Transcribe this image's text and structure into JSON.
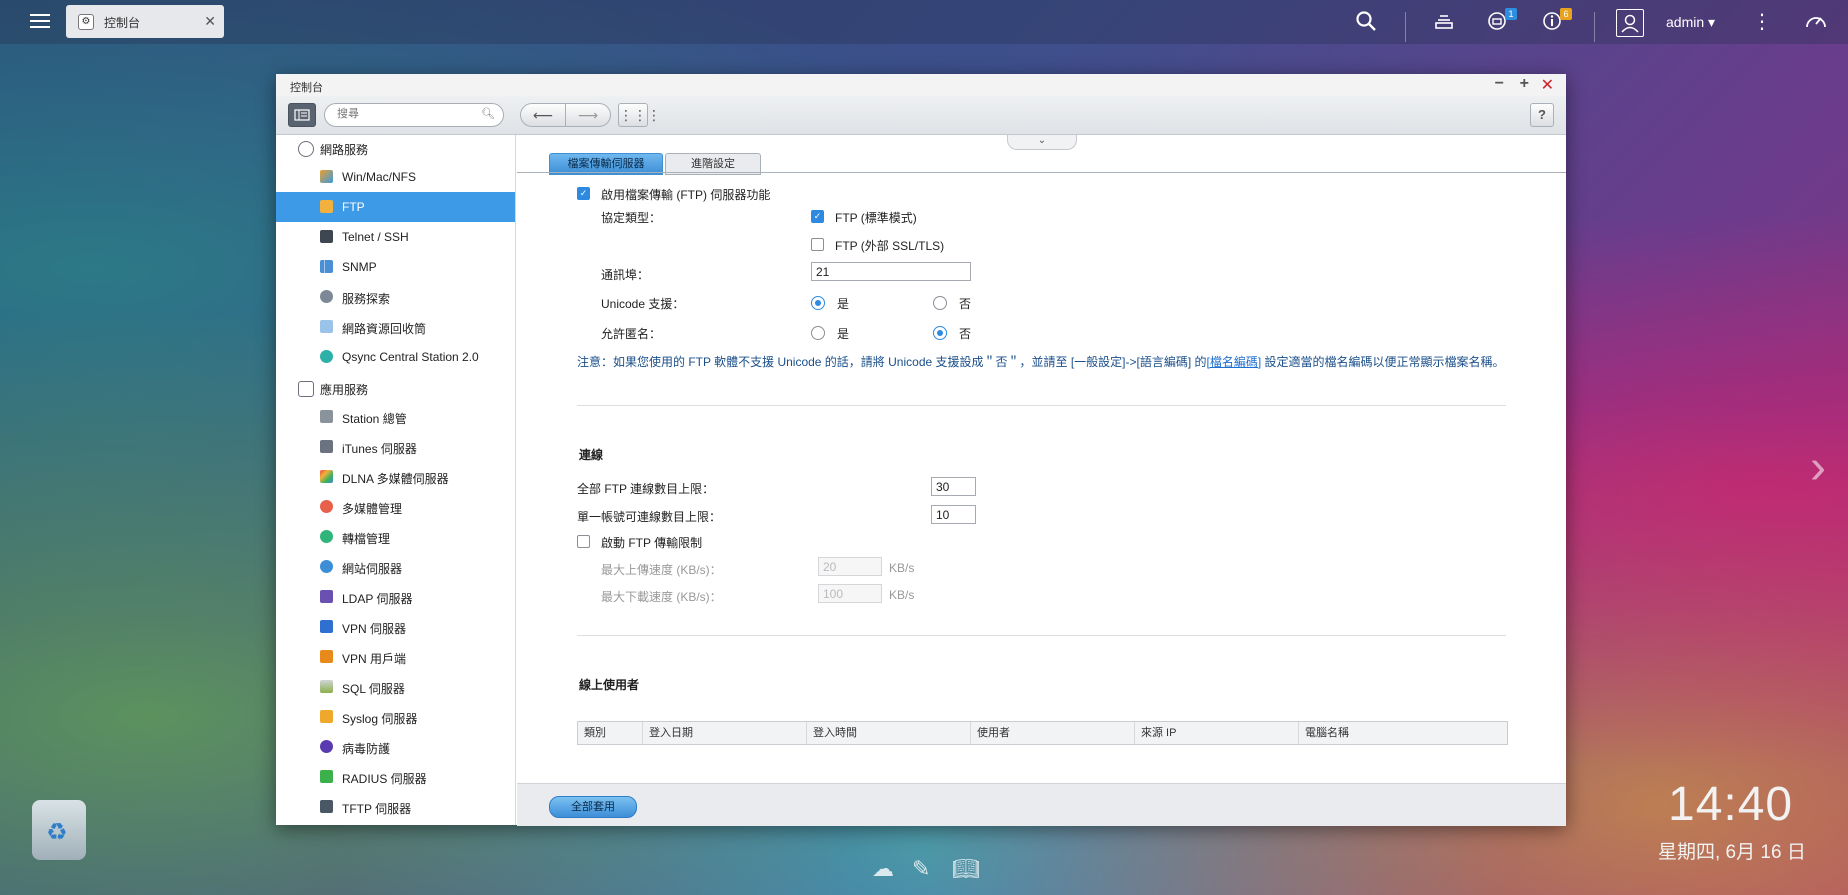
{
  "taskbar": {
    "tab_label": "控制台",
    "user": "admin",
    "badge_1": "1",
    "badge_2": "6"
  },
  "window": {
    "title": "控制台",
    "search_placeholder": "搜尋",
    "help_label": "?"
  },
  "sidebar": {
    "group_network": "網路服務",
    "group_apps": "應用服務",
    "network_items": [
      {
        "label": "Win/Mac/NFS",
        "icon": "winmac-icon"
      },
      {
        "label": "FTP",
        "icon": "ftp-icon"
      },
      {
        "label": "Telnet / SSH",
        "icon": "telnet-icon"
      },
      {
        "label": "SNMP",
        "icon": "snmp-icon"
      },
      {
        "label": "服務探索",
        "icon": "discovery-icon"
      },
      {
        "label": "網路資源回收筒",
        "icon": "network-recycle-icon"
      },
      {
        "label": "Qsync Central Station 2.0",
        "icon": "qsync-icon"
      }
    ],
    "app_items": [
      {
        "label": "Station 總管",
        "icon": "station-icon"
      },
      {
        "label": "iTunes 伺服器",
        "icon": "itunes-icon"
      },
      {
        "label": "DLNA 多媒體伺服器",
        "icon": "dlna-icon"
      },
      {
        "label": "多媒體管理",
        "icon": "multimedia-icon"
      },
      {
        "label": "轉檔管理",
        "icon": "transcode-icon"
      },
      {
        "label": "網站伺服器",
        "icon": "web-server-icon"
      },
      {
        "label": "LDAP 伺服器",
        "icon": "ldap-icon"
      },
      {
        "label": "VPN 伺服器",
        "icon": "vpn-server-icon"
      },
      {
        "label": "VPN 用戶端",
        "icon": "vpn-client-icon"
      },
      {
        "label": "SQL 伺服器",
        "icon": "sql-icon"
      },
      {
        "label": "Syslog 伺服器",
        "icon": "syslog-icon"
      },
      {
        "label": "病毒防護",
        "icon": "antivirus-icon"
      },
      {
        "label": "RADIUS 伺服器",
        "icon": "radius-icon"
      },
      {
        "label": "TFTP 伺服器",
        "icon": "tftp-icon"
      }
    ]
  },
  "tabs": [
    "檔案傳輸伺服器",
    "進階設定"
  ],
  "form": {
    "enable_ftp": "啟用檔案傳輸 (FTP) 伺服器功能",
    "protocol_label": "協定類型：",
    "protocol_ftp": "FTP (標準模式)",
    "protocol_ssl": "FTP (外部 SSL/TLS)",
    "port_label": "通訊埠：",
    "port_value": "21",
    "unicode_label": "Unicode 支援：",
    "anonymous_label": "允許匿名：",
    "yes": "是",
    "no": "否",
    "note_prefix": "注意：如果您使用的 FTP 軟體不支援 Unicode 的話，請將 Unicode 支援設成＂否＂，並請至 [一般設定]->[語言編碼] 的",
    "note_link": "[檔名編碼]",
    "note_suffix": " 設定適當的檔名編碼以便正常顯示檔案名稱。"
  },
  "connection": {
    "title": "連線",
    "total_label": "全部 FTP 連線數目上限：",
    "total_value": "30",
    "per_account_label": "單一帳號可連線數目上限：",
    "per_account_value": "10",
    "limit_label": "啟動 FTP 傳輸限制",
    "upload_label": "最大上傳速度 (KB/s)：",
    "upload_value": "20",
    "download_label": "最大下載速度 (KB/s)：",
    "download_value": "100",
    "unit": "KB/s"
  },
  "online_users": {
    "title": "線上使用者",
    "columns": [
      "類別",
      "登入日期",
      "登入時間",
      "使用者",
      "來源 IP",
      "電腦名稱"
    ]
  },
  "footer": {
    "apply": "全部套用"
  },
  "desktop": {
    "time": "14:40",
    "date": "星期四, 6月 16 日"
  }
}
